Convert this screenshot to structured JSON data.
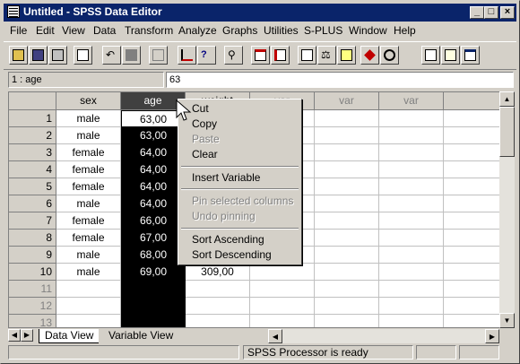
{
  "window": {
    "title": "Untitled - SPSS Data Editor"
  },
  "menu": [
    "File",
    "Edit",
    "View",
    "Data",
    "Transform",
    "Analyze",
    "Graphs",
    "Utilities",
    "S-PLUS",
    "Window",
    "Help"
  ],
  "toolbar": {
    "icons": [
      "open-icon",
      "save-icon",
      "print-icon",
      "dialog-recall-icon",
      "undo-icon",
      "redo-icon",
      "goto-chart-icon",
      "goto-case-icon",
      "variables-icon",
      "find-icon",
      "insert-case-icon",
      "insert-variable-icon",
      "split-file-icon",
      "weight-cases-icon",
      "select-cases-icon",
      "value-labels-icon",
      "use-sets-icon",
      "stop-icon",
      "show-sets-icon",
      "designate-window-icon"
    ]
  },
  "cell_editor": {
    "ref": "1 : age",
    "value": "63"
  },
  "grid": {
    "columns": [
      "sex",
      "age",
      "weight",
      "var",
      "var",
      "var"
    ],
    "rows": [
      {
        "num": "1",
        "sex": "male",
        "age": "63,00",
        "c3": ""
      },
      {
        "num": "2",
        "sex": "male",
        "age": "63,00",
        "c3": ""
      },
      {
        "num": "3",
        "sex": "female",
        "age": "64,00",
        "c3": ""
      },
      {
        "num": "4",
        "sex": "female",
        "age": "64,00",
        "c3": ""
      },
      {
        "num": "5",
        "sex": "female",
        "age": "64,00",
        "c3": ""
      },
      {
        "num": "6",
        "sex": "male",
        "age": "64,00",
        "c3": ""
      },
      {
        "num": "7",
        "sex": "female",
        "age": "66,00",
        "c3": ""
      },
      {
        "num": "8",
        "sex": "female",
        "age": "67,00",
        "c3": ""
      },
      {
        "num": "9",
        "sex": "male",
        "age": "68,00",
        "c3": ""
      },
      {
        "num": "10",
        "sex": "male",
        "age": "69,00",
        "c3": "309,00"
      }
    ],
    "empty_rows": [
      "11",
      "12",
      "13"
    ]
  },
  "context_menu": {
    "items": [
      {
        "label": "Cut",
        "enabled": true
      },
      {
        "label": "Copy",
        "enabled": true
      },
      {
        "label": "Paste",
        "enabled": false
      },
      {
        "label": "Clear",
        "enabled": true
      },
      {
        "label": "Insert Variable",
        "enabled": true
      },
      {
        "label": "Pin selected columns",
        "enabled": false
      },
      {
        "label": "Undo pinning",
        "enabled": false
      },
      {
        "label": "Sort Ascending",
        "enabled": true
      },
      {
        "label": "Sort Descending",
        "enabled": true
      }
    ]
  },
  "tabs": [
    "Data View",
    "Variable View"
  ],
  "status": {
    "processor": "SPSS Processor  is ready"
  },
  "colors": {
    "title_bar": "#0a246a",
    "face": "#d4d0c8",
    "selection": "#000000"
  }
}
